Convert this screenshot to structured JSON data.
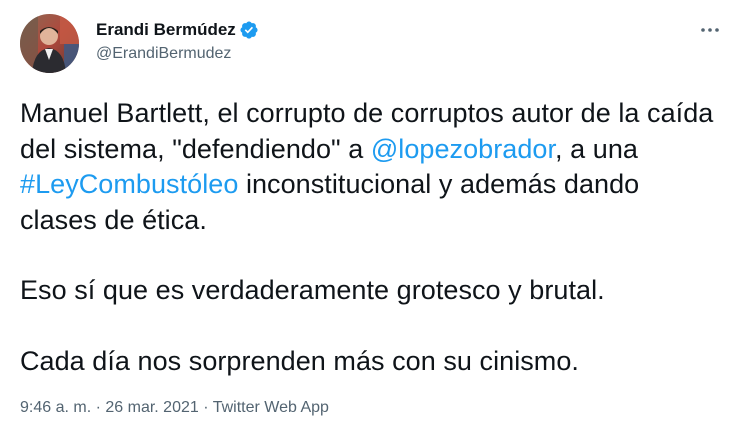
{
  "author": {
    "display_name": "Erandi Bermúdez",
    "handle": "@ErandiBermudez",
    "verified": true,
    "verified_color": "#1d9bf0"
  },
  "menu": {
    "more_glyph": "⋯"
  },
  "tweet": {
    "paragraphs": [
      {
        "segments": [
          {
            "text": "Manuel Bartlett, el corrupto de corruptos autor de la caída del sistema, \"defendiendo\" a ",
            "type": "text"
          },
          {
            "text": "@lopezobrador",
            "type": "mention"
          },
          {
            "text": ", a una ",
            "type": "text"
          },
          {
            "text": "#LeyCombustóleo",
            "type": "hashtag"
          },
          {
            "text": " inconstitucional y además dando clases de ética.",
            "type": "text"
          }
        ]
      },
      {
        "segments": [
          {
            "text": "Eso sí que es verdaderamente grotesco y brutal.",
            "type": "text"
          }
        ]
      },
      {
        "segments": [
          {
            "text": "Cada día nos sorprenden más con su cinismo.",
            "type": "text"
          }
        ]
      }
    ],
    "link_color": "#1d9bf0"
  },
  "meta": {
    "time": "9:46 a. m.",
    "separator": " · ",
    "date": "26 mar. 2021",
    "source": "Twitter Web App"
  }
}
